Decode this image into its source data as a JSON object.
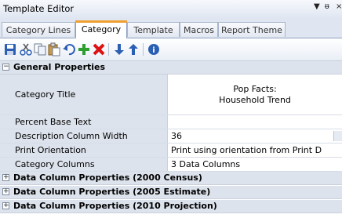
{
  "window": {
    "title": "Template Editor"
  },
  "tabs": [
    {
      "label": "Category Lines"
    },
    {
      "label": "Category"
    },
    {
      "label": "Template"
    },
    {
      "label": "Macros"
    },
    {
      "label": "Report Theme"
    }
  ],
  "active_tab": "Category",
  "toolbar": {
    "buttons": [
      "save-icon",
      "cut-icon",
      "copy-icon",
      "paste-icon",
      "undo-icon",
      "add-icon",
      "delete-icon",
      "move-down-icon",
      "move-up-icon",
      "help-icon"
    ]
  },
  "properties": {
    "general": {
      "header": "General Properties",
      "expanded": true,
      "rows": {
        "category_title": {
          "name": "Category Title",
          "value_line1": "Pop Facts:",
          "value_line2": "Household Trend"
        },
        "percent_base_text": {
          "name": "Percent Base Text",
          "value": ""
        },
        "description_column_width": {
          "name": "Description Column Width",
          "value": "36"
        },
        "print_orientation": {
          "name": "Print Orientation",
          "value": "Print using orientation from Print D"
        },
        "category_columns": {
          "name": "Category Columns",
          "value": "3 Data Columns"
        }
      }
    },
    "collapsed_sections": [
      {
        "label": "Data Column Properties (2000 Census)"
      },
      {
        "label": "Data Column Properties (2005 Estimate)"
      },
      {
        "label": "Data Column Properties (2010 Projection)"
      }
    ]
  },
  "colors": {
    "active_tab_accent": "#f0a030",
    "category_row_bg": "#dde3ec",
    "header_bg": "#dfe6f1"
  }
}
